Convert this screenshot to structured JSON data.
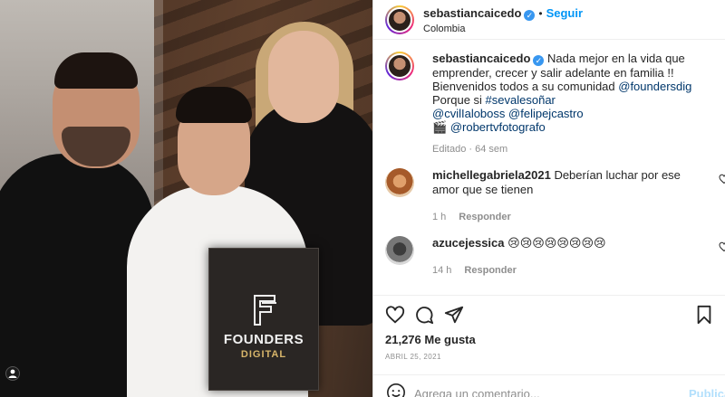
{
  "post": {
    "author": "sebastiancaicedo",
    "follow_label": "Seguir",
    "dot": "•",
    "location": "Colombia"
  },
  "photo": {
    "book_title": "FOUNDERS",
    "book_subtitle": "DIGITAL"
  },
  "caption": {
    "author": "sebastiancaicedo",
    "line1": "Nada mejor en la vida que emprender, crecer y salir adelante en familia !!",
    "line2_prefix": "Bienvenidos todos a su comunidad ",
    "mention_foundersdig": "@foundersdig",
    "line3_prefix": "Porque si ",
    "hashtag": "#sevalesoñar",
    "mention_cvillaloboss": "@cvilIaloboss",
    "mention_felipejcastro": "@felipejcastro",
    "camera_emoji": "🎬",
    "mention_robertvfotografo": "@robertvfotografo",
    "edited": "Editado · 64 sem"
  },
  "comments": [
    {
      "user": "michellegabriela2021",
      "text": "Deberían luchar por ese amor que se tienen",
      "time": "1 h",
      "reply_label": "Responder"
    },
    {
      "user": "azucejessica",
      "text": "😢😢😢😢😢😢😢😢",
      "time": "14 h",
      "reply_label": "Responder"
    }
  ],
  "stats": {
    "likes_count": "21,276",
    "likes_label": "Me gusta",
    "date": "ABRIL 25, 2021"
  },
  "composer": {
    "placeholder": "Agrega un comentario...",
    "publish_label": "Publica"
  },
  "colors": {
    "accent": "#0095f6",
    "verified": "#3897f0",
    "mention": "#00376b",
    "muted": "#8e8e8e"
  }
}
